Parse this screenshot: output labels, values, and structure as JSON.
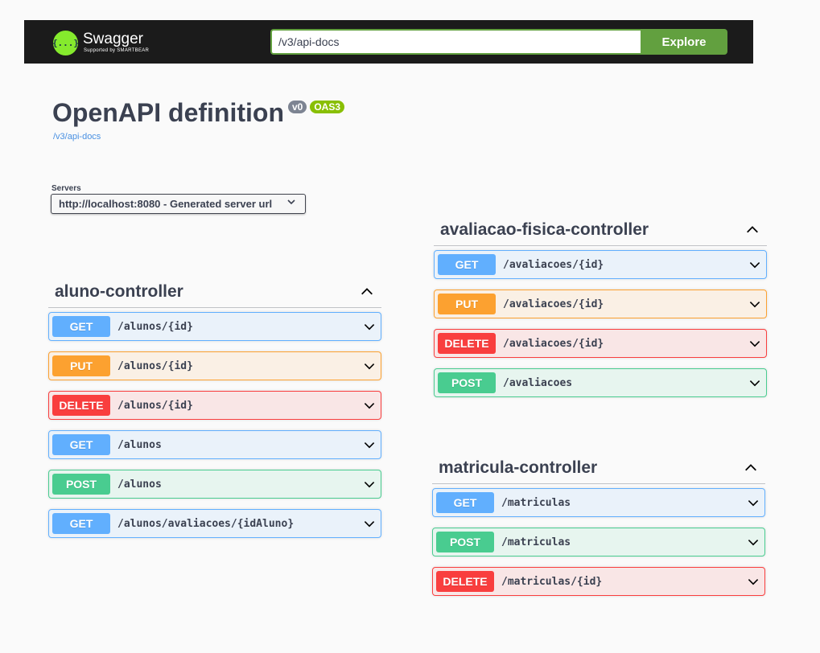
{
  "topbar": {
    "logo_mark": "{...}",
    "logo_title": "Swagger",
    "logo_subtitle": "Supported by SMARTBEAR",
    "url_value": "/v3/api-docs",
    "explore_label": "Explore"
  },
  "info": {
    "title": "OpenAPI definition",
    "version": "v0",
    "oas": "OAS3",
    "link": "/v3/api-docs"
  },
  "servers": {
    "label": "Servers",
    "selected": "http://localhost:8080 - Generated server url"
  },
  "tags": [
    {
      "name": "aluno-controller",
      "operations": [
        {
          "method": "GET",
          "path": "/alunos/{id}"
        },
        {
          "method": "PUT",
          "path": "/alunos/{id}"
        },
        {
          "method": "DELETE",
          "path": "/alunos/{id}"
        },
        {
          "method": "GET",
          "path": "/alunos"
        },
        {
          "method": "POST",
          "path": "/alunos"
        },
        {
          "method": "GET",
          "path": "/alunos/avaliacoes/{idAluno}"
        }
      ]
    },
    {
      "name": "avaliacao-fisica-controller",
      "operations": [
        {
          "method": "GET",
          "path": "/avaliacoes/{id}"
        },
        {
          "method": "PUT",
          "path": "/avaliacoes/{id}"
        },
        {
          "method": "DELETE",
          "path": "/avaliacoes/{id}"
        },
        {
          "method": "POST",
          "path": "/avaliacoes"
        }
      ]
    },
    {
      "name": "matricula-controller",
      "operations": [
        {
          "method": "GET",
          "path": "/matriculas"
        },
        {
          "method": "POST",
          "path": "/matriculas"
        },
        {
          "method": "DELETE",
          "path": "/matriculas/{id}"
        }
      ]
    }
  ],
  "colors": {
    "get": "#61affe",
    "put": "#fca130",
    "delete": "#f93e3e",
    "post": "#49cc90",
    "explore": "#62a03f",
    "topbar": "#1b1b1b"
  }
}
